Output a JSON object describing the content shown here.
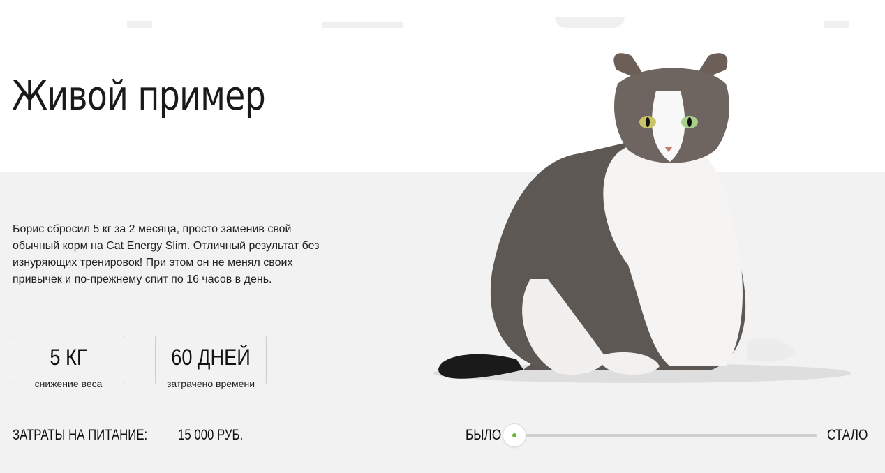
{
  "section": {
    "title": "Живой пример",
    "description": "Борис сбросил 5 кг за 2 месяца, просто заменив свой обычный корм на Cat Energy Slim. Отличный результат без изнуряющих тренировок! При этом он не менял своих привычек и по-прежнему спит по 16 часов в день."
  },
  "stats": [
    {
      "value": "5 КГ",
      "caption": "снижение веса"
    },
    {
      "value": "60 ДНЕЙ",
      "caption": "затрачено времени"
    }
  ],
  "cost": {
    "label": "ЗАТРАТЫ НА ПИТАНИЕ:",
    "value": "15 000 РУБ."
  },
  "slider": {
    "before_label": "БЫЛО",
    "after_label": "СТАЛО",
    "position": 0
  },
  "colors": {
    "accent": "#68b738",
    "band": "#f2f2f2",
    "text": "#222222"
  },
  "icons": {
    "cat_image": "fat-cat-photo"
  }
}
